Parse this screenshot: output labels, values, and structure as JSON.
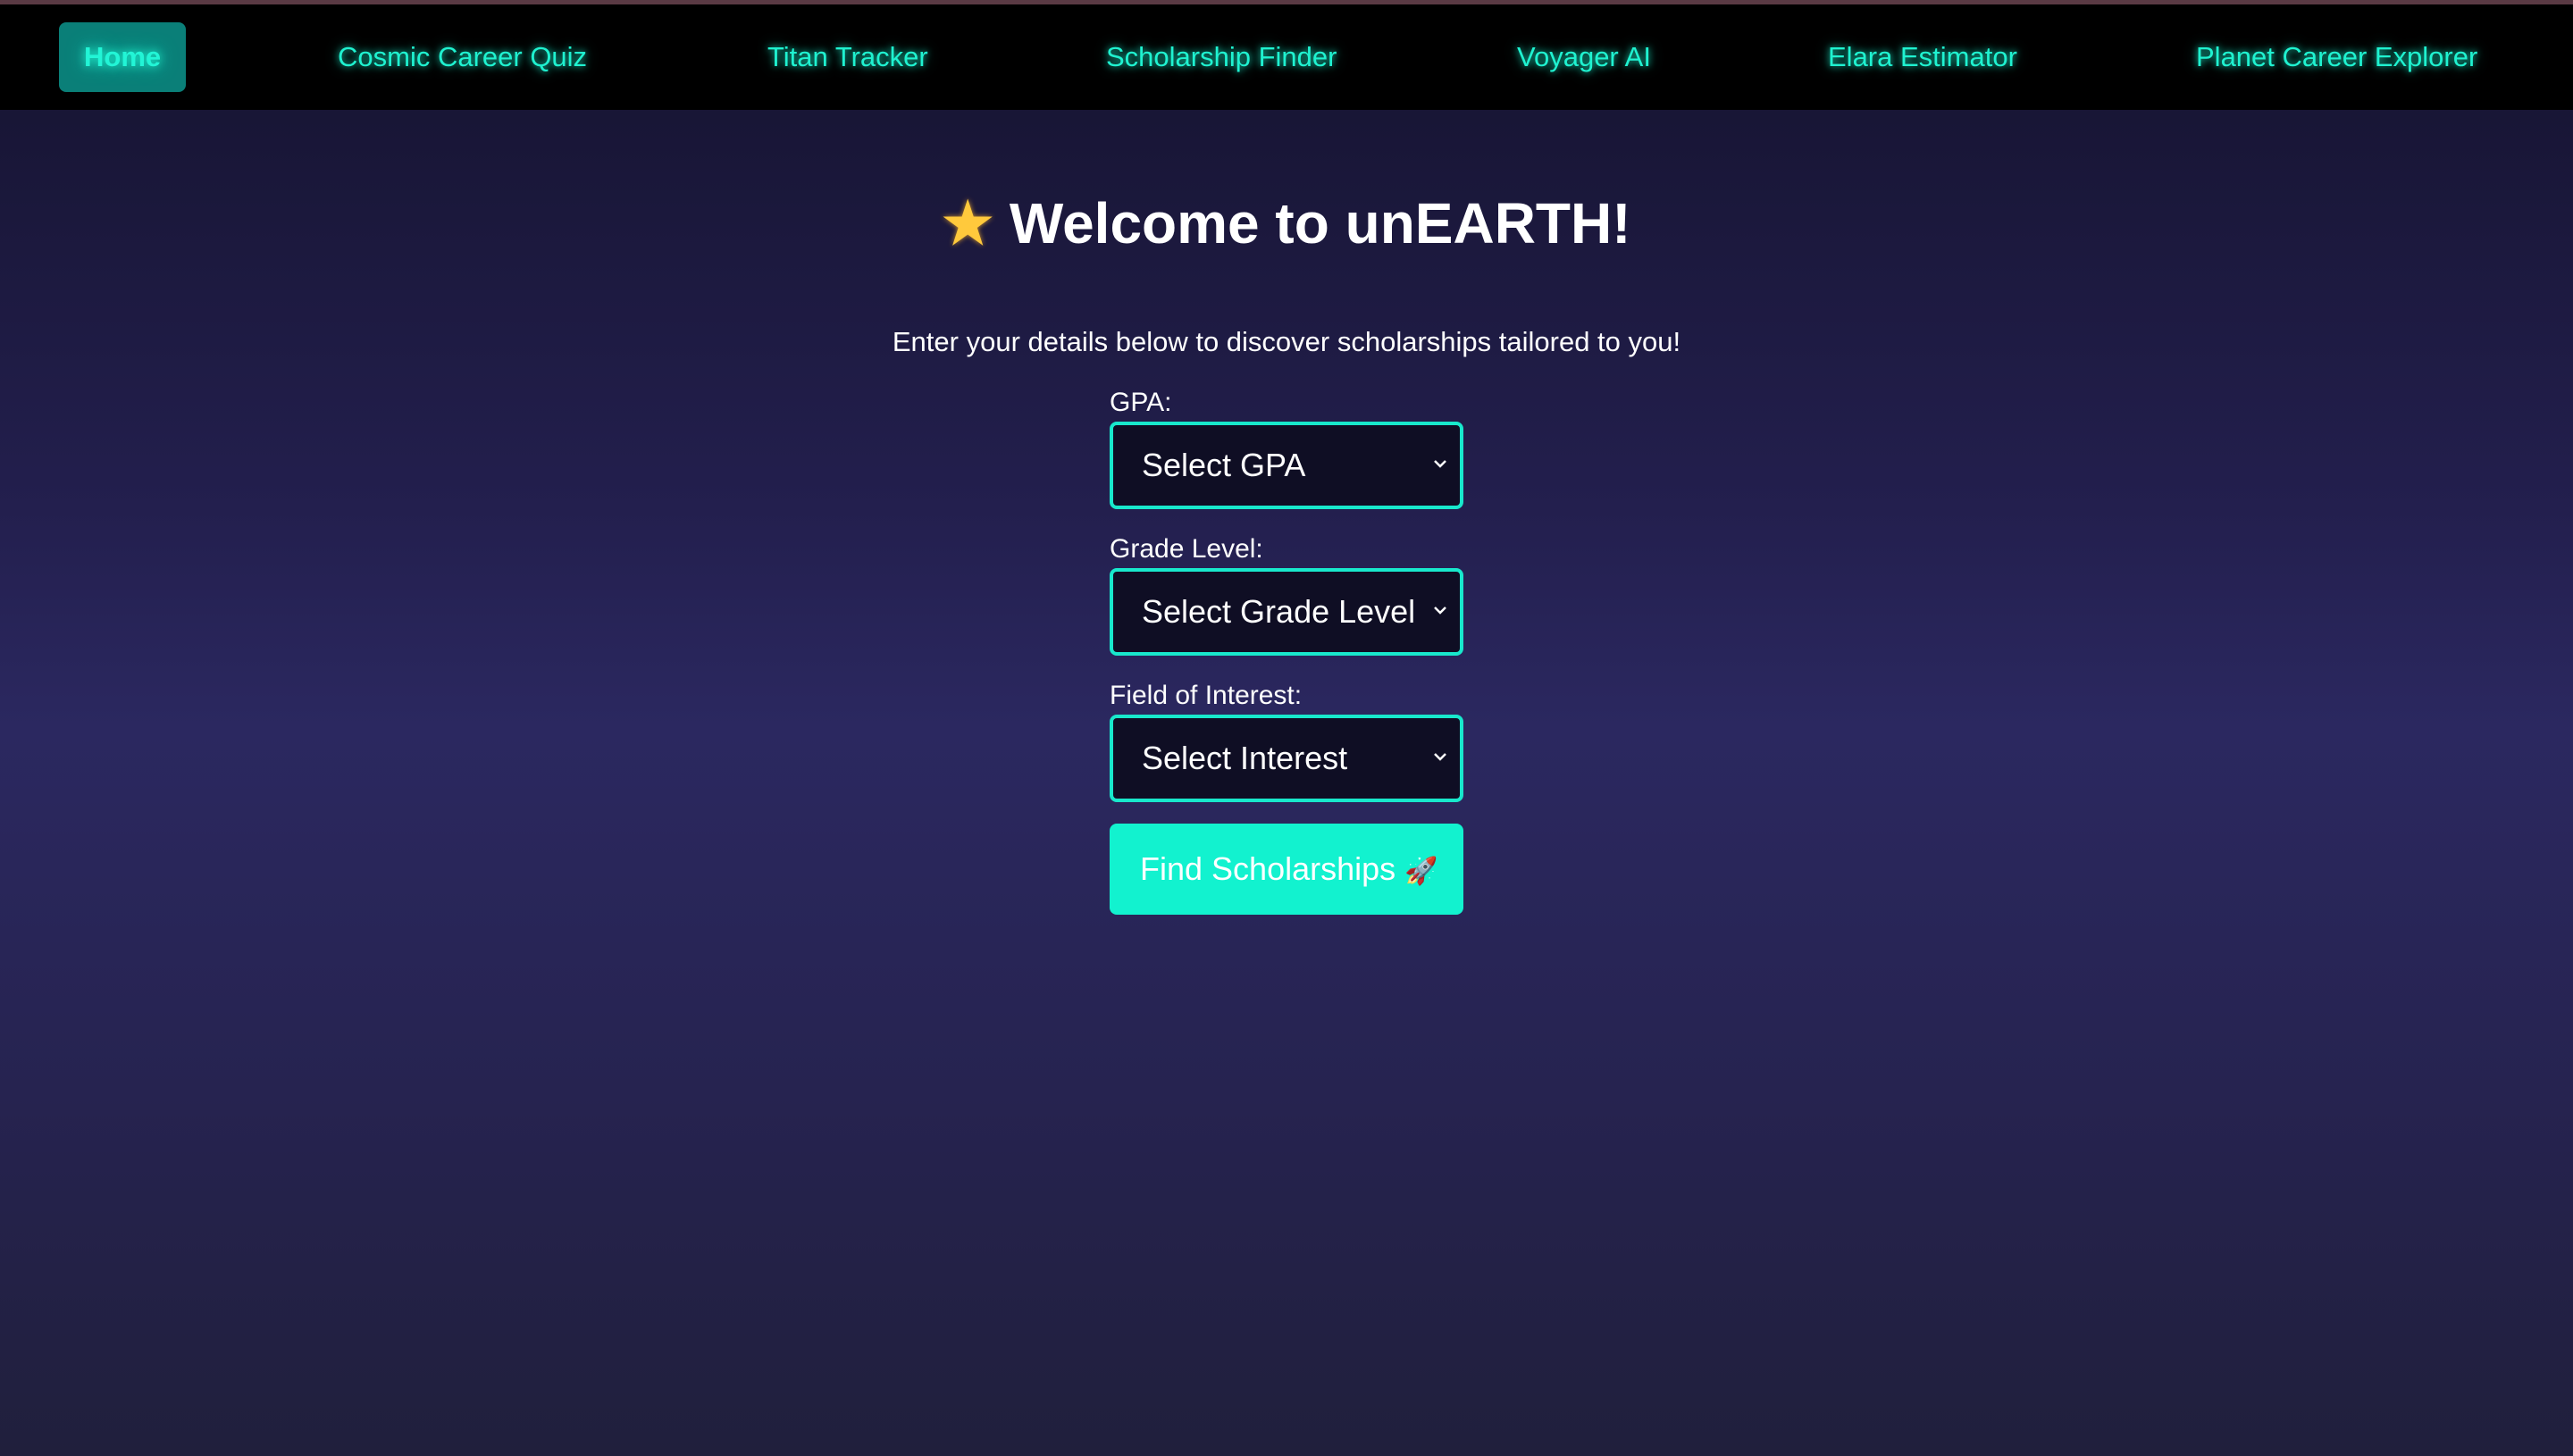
{
  "nav": {
    "items": [
      {
        "label": "Home",
        "active": true
      },
      {
        "label": "Cosmic Career Quiz"
      },
      {
        "label": "Titan Tracker"
      },
      {
        "label": "Scholarship Finder"
      },
      {
        "label": "Voyager AI"
      },
      {
        "label": "Elara Estimator"
      },
      {
        "label": "Planet Career Explorer"
      }
    ]
  },
  "main": {
    "title": "Welcome to unEARTH!",
    "title_icon": "star-icon",
    "subtitle": "Enter your details below to discover scholarships tailored to you!",
    "form": {
      "gpa_label": "GPA:",
      "gpa_value": "Select GPA",
      "grade_label": "Grade Level:",
      "grade_value": "Select Grade Level",
      "interest_label": "Field of Interest:",
      "interest_value": "Select Interest",
      "submit_label": "Find Scholarships",
      "submit_icon": "rocket-icon"
    }
  },
  "colors": {
    "accent": "#12f2cf",
    "nav_background": "#000000",
    "nav_active": "#0a7f78",
    "select_background": "#0f0e24"
  }
}
